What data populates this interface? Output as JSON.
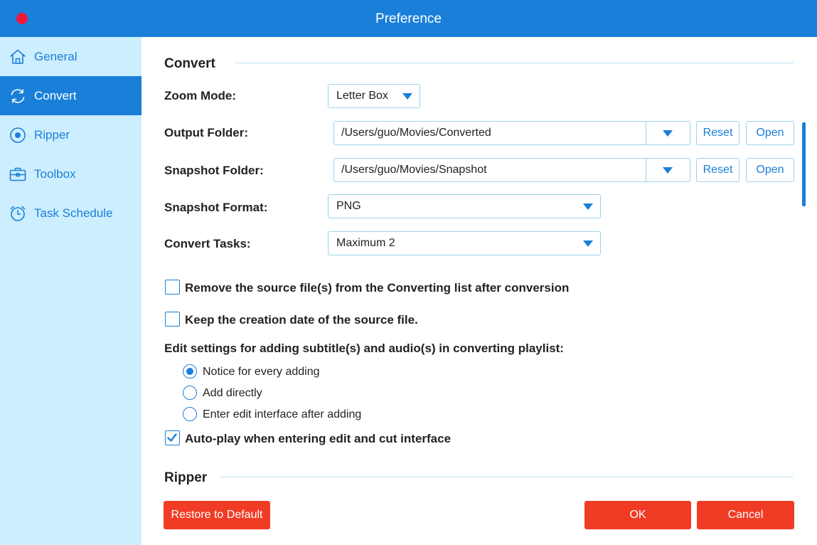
{
  "window": {
    "title": "Preference"
  },
  "sidebar": {
    "items": [
      {
        "label": "General",
        "icon": "home-icon"
      },
      {
        "label": "Convert",
        "icon": "convert-icon",
        "active": true
      },
      {
        "label": "Ripper",
        "icon": "disc-icon"
      },
      {
        "label": "Toolbox",
        "icon": "toolbox-icon"
      },
      {
        "label": "Task Schedule",
        "icon": "alarm-clock-icon"
      }
    ]
  },
  "convert": {
    "heading": "Convert",
    "zoom_mode": {
      "label": "Zoom Mode:",
      "value": "Letter Box"
    },
    "output_folder": {
      "label": "Output Folder:",
      "value": "/Users/guo/Movies/Converted",
      "reset": "Reset",
      "open": "Open"
    },
    "snapshot_folder": {
      "label": "Snapshot Folder:",
      "value": "/Users/guo/Movies/Snapshot",
      "reset": "Reset",
      "open": "Open"
    },
    "snapshot_format": {
      "label": "Snapshot Format:",
      "value": "PNG"
    },
    "convert_tasks": {
      "label": "Convert Tasks:",
      "value": "Maximum 2"
    },
    "remove_source": {
      "label": "Remove the source file(s) from the Converting list after conversion",
      "checked": false
    },
    "keep_date": {
      "label": "Keep the creation date of the source file.",
      "checked": false
    },
    "edit_settings": {
      "label": "Edit settings for adding subtitle(s) and audio(s) in converting playlist:",
      "options": [
        {
          "label": "Notice for every adding",
          "selected": true
        },
        {
          "label": "Add directly",
          "selected": false
        },
        {
          "label": "Enter edit interface after adding",
          "selected": false
        }
      ]
    },
    "autoplay": {
      "label": "Auto-play when entering edit and cut interface",
      "checked": true
    }
  },
  "ripper": {
    "heading": "Ripper"
  },
  "footer": {
    "restore": "Restore to Default",
    "ok": "OK",
    "cancel": "Cancel"
  },
  "colors": {
    "accent": "#1a7fd9",
    "sidebar_bg": "#cdeefe",
    "danger": "#f13c25",
    "close_dot": "#f0183c"
  }
}
